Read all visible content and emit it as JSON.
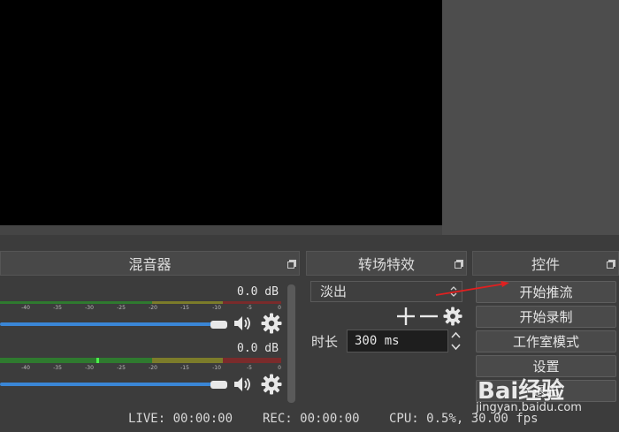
{
  "docks": {
    "mixer": {
      "title": "混音器"
    },
    "transitions": {
      "title": "转场特效"
    },
    "controls": {
      "title": "控件"
    }
  },
  "mixer": {
    "channels": [
      {
        "db": "0.0 dB",
        "level": 0.0,
        "volume": 0.75
      },
      {
        "db": "0.0 dB",
        "level": 0.34,
        "volume": 0.75
      }
    ],
    "ticks": [
      "-40",
      "-35",
      "-30",
      "-25",
      "-20",
      "-15",
      "-10",
      "-5",
      "0"
    ]
  },
  "transitions": {
    "selected": "淡出",
    "duration_label": "时长",
    "duration_value": "300 ms"
  },
  "controls": {
    "start_streaming": "开始推流",
    "start_recording": "开始录制",
    "studio_mode": "工作室模式",
    "settings": "设置",
    "exit": "退出"
  },
  "status": {
    "live": "LIVE: 00:00:00",
    "rec": "REC: 00:00:00",
    "cpu": "CPU: 0.5%, 30.00 fps"
  },
  "watermark": {
    "brand": "Bai经验",
    "url": "jingyan.baidu.com"
  },
  "colors": {
    "background": "#3c3c3c",
    "preview": "#000000",
    "meter_green": "#2f7a2f",
    "meter_yellow": "#7c7c2a",
    "meter_red": "#7a2b2b",
    "volume_slider": "#3a86d6",
    "annotation_arrow": "#e02020"
  }
}
